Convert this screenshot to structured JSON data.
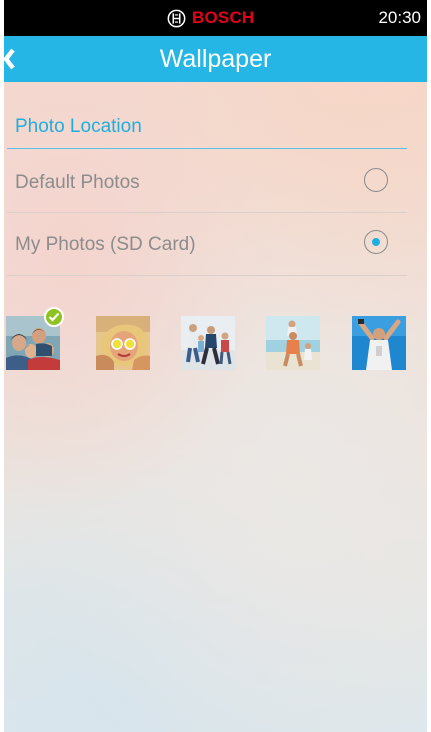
{
  "status_bar": {
    "brand": "BOSCH",
    "time": "20:30",
    "brand_color": "#e2001a"
  },
  "header": {
    "title": "Wallpaper",
    "back_icon": "chevron-left-icon",
    "color": "#26b6e6"
  },
  "section": {
    "title": "Photo Location"
  },
  "options": [
    {
      "label": "Default Photos",
      "selected": false
    },
    {
      "label": "My Photos (SD Card)",
      "selected": true
    }
  ],
  "thumbnails": [
    {
      "name": "family-photo",
      "selected": true
    },
    {
      "name": "girl-sunglasses-photo",
      "selected": false
    },
    {
      "name": "family-running-photo",
      "selected": false
    },
    {
      "name": "beach-piggyback-photo",
      "selected": false
    },
    {
      "name": "cheering-person-photo",
      "selected": false
    }
  ],
  "accent_color": "#1eaee0",
  "selected_badge_icon": "checkmark-icon"
}
